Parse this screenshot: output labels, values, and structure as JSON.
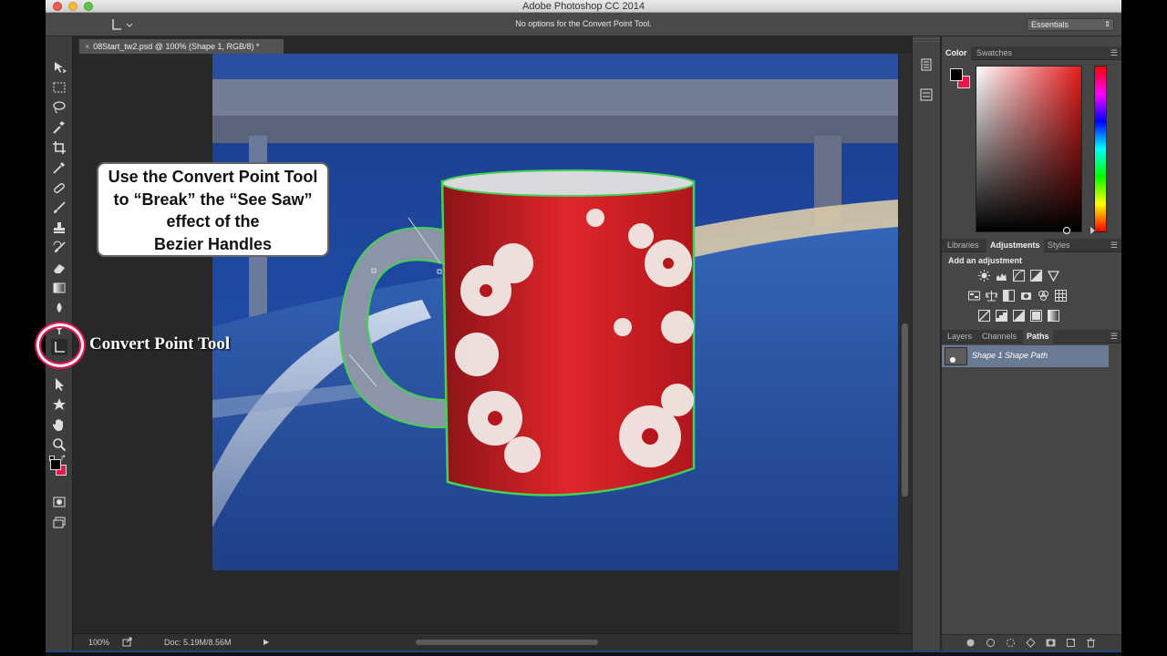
{
  "window": {
    "title": "Adobe Photoshop CC 2014"
  },
  "options_bar": {
    "message": "No options for the Convert Point Tool.",
    "workspace": "Essentials"
  },
  "document": {
    "tab_label": "08Start_tw2.psd @ 100% (Shape 1, RGB/8) *",
    "close_glyph": "×"
  },
  "status": {
    "zoom": "100%",
    "doc_size": "Doc: 5.19M/8.56M"
  },
  "panels": {
    "color_tabs": [
      "Color",
      "Swatches"
    ],
    "color": {
      "foreground": "#000000",
      "background": "#e51a4b"
    },
    "adjust_tabs": [
      "Libraries",
      "Adjustments",
      "Styles"
    ],
    "adjust_title": "Add an adjustment",
    "layers_tabs": [
      "Layers",
      "Channels",
      "Paths"
    ],
    "paths": [
      {
        "name": "Shape 1 Shape Path"
      }
    ]
  },
  "callout": {
    "lines": [
      "Use the Convert Point Tool",
      "to “Break” the “See Saw”",
      "effect of the",
      "Bezier Handles"
    ]
  },
  "highlight_label": "Convert Point Tool",
  "menu_glyph": "☰"
}
